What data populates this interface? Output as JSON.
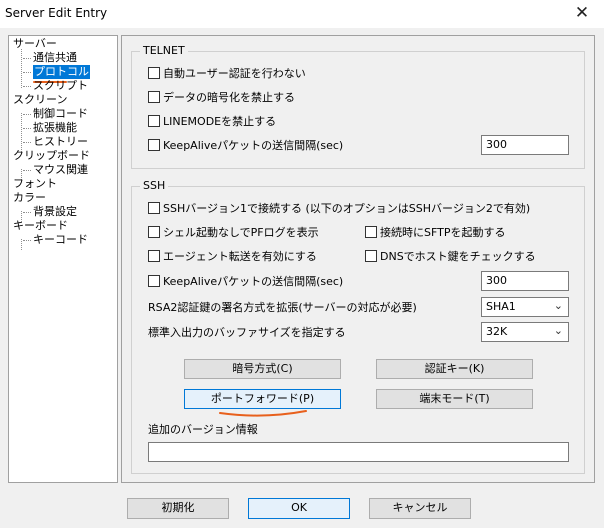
{
  "window": {
    "title": "Server Edit Entry",
    "close_glyph": "✕"
  },
  "tree": {
    "items": [
      {
        "label": "サーバー",
        "level": 0
      },
      {
        "label": "通信共通",
        "level": 1
      },
      {
        "label": "プロトコル",
        "level": 1,
        "selected": true
      },
      {
        "label": "スクリプト",
        "level": 1
      },
      {
        "label": "スクリーン",
        "level": 0
      },
      {
        "label": "制御コード",
        "level": 1
      },
      {
        "label": "拡張機能",
        "level": 1
      },
      {
        "label": "ヒストリー",
        "level": 1
      },
      {
        "label": "クリップボード",
        "level": 0
      },
      {
        "label": "マウス関連",
        "level": 1
      },
      {
        "label": "フォント",
        "level": 0
      },
      {
        "label": "カラー",
        "level": 0
      },
      {
        "label": "背景設定",
        "level": 1
      },
      {
        "label": "キーボード",
        "level": 0
      },
      {
        "label": "キーコード",
        "level": 1
      }
    ]
  },
  "telnet": {
    "title": "TELNET",
    "auto_auth": "自動ユーザー認証を行わない",
    "no_encrypt": "データの暗号化を禁止する",
    "no_linemode": "LINEMODEを禁止する",
    "keepalive": "KeepAliveパケットの送信間隔(sec)",
    "keepalive_value": "300"
  },
  "ssh": {
    "title": "SSH",
    "ssh1": "SSHバージョン1で接続する (以下のオプションはSSHバージョン2で有効)",
    "no_shell": "シェル起動なしでPFログを表示",
    "sftp_on_connect": "接続時にSFTPを起動する",
    "agent_forward": "エージェント転送を有効にする",
    "dns_hostkey": "DNSでホスト鍵をチェックする",
    "keepalive": "KeepAliveパケットの送信間隔(sec)",
    "keepalive_value": "300",
    "rsa_label": "RSA2認証鍵の署名方式を拡張(サーバーの対応が必要)",
    "rsa_value": "SHA1",
    "buffer_label": "標準入出力のバッファサイズを指定する",
    "buffer_value": "32K",
    "cipher_btn": "暗号方式(C)",
    "auth_key_btn": "認証キー(K)",
    "port_forward_btn": "ポートフォワード(P)",
    "terminal_mode_btn": "端末モード(T)",
    "extra_version_label": "追加のバージョン情報",
    "extra_version_value": ""
  },
  "footer": {
    "reset": "初期化",
    "ok": "OK",
    "cancel": "キャンセル"
  },
  "colors": {
    "selection": "#0078d7",
    "annotation": "#e8601c"
  }
}
